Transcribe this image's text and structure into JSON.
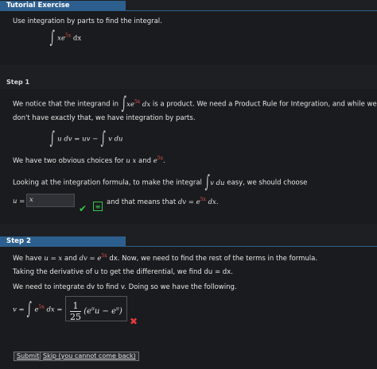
{
  "header": {
    "title": "Tutorial Exercise"
  },
  "problem": {
    "instruction": "Use integration by parts to find the integral.",
    "integrand": "xe",
    "exponent": "5x",
    "dx": "dx"
  },
  "step1": {
    "label": "Step 1",
    "line1_a": "We notice that the integrand in",
    "line1_integrand": "xe",
    "line1_exp": "5x",
    "line1_dx": "dx",
    "line1_b": "is a product. We need a Product Rule for Integration, and while we",
    "line2": "don't have exactly that, we have integration by parts.",
    "formula_left": "u dv = uv −",
    "formula_right": "v du",
    "choices_a": "We have two obvious choices for",
    "choices_u": "u",
    "choices_x": "x",
    "choices_and": "and",
    "choices_e": "e",
    "choices_exp": "5x",
    "choices_end": ".",
    "looking_a": "Looking at the integration formula, to make the integral",
    "looking_int": "v du",
    "looking_b": "easy, we should choose",
    "u_label": "u =",
    "u_value": "x",
    "eq_button": "≡",
    "means_a": "and that means that",
    "means_dv": "dv = e",
    "means_exp": "5x",
    "means_dx": "dx."
  },
  "step2": {
    "label": "Step 2",
    "line1_a": "We have",
    "line1_u": "u = x",
    "line1_and": "and",
    "line1_dv": "dv = e",
    "line1_exp": "5x",
    "line1_b": "dx. Now, we need to find the rest of the terms in the formula.",
    "line2": "Taking the derivative of u to get the differential, we find du = dx.",
    "line3": "We need to integrate dv to find v. Doing so we have the following.",
    "v_label": "v =",
    "v_e": "e",
    "v_exp": "5x",
    "v_dx": "dx =",
    "ans_num": "1",
    "ans_den": "25",
    "ans_body": "(e",
    "ans_exp1": "u",
    "ans_mid": "u − e",
    "ans_exp2": "u",
    "ans_close": ")"
  },
  "buttons": {
    "submit": "Submit",
    "skip": "Skip (you cannot come back)"
  }
}
